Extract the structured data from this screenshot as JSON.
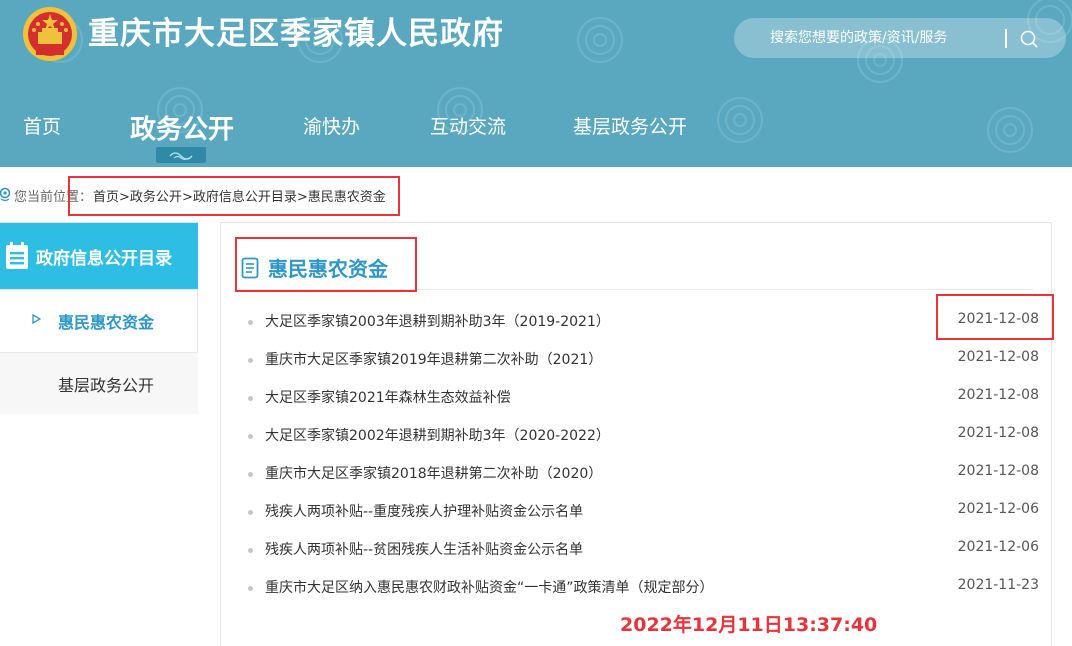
{
  "header": {
    "site_title": "重庆市大足区季家镇人民政府",
    "search_placeholder": "搜索您想要的政策/资讯/服务",
    "nav": [
      {
        "label": "首页"
      },
      {
        "label": "政务公开",
        "active": true
      },
      {
        "label": "渝快办"
      },
      {
        "label": "互动交流"
      },
      {
        "label": "基层政务公开"
      }
    ]
  },
  "breadcrumb": {
    "label": "您当前位置：",
    "items": [
      "首页",
      "政务公开",
      "政府信息公开目录",
      "惠民惠农资金"
    ],
    "separator": ">"
  },
  "sidebar": {
    "title": "政府信息公开目录",
    "items": [
      {
        "label": "惠民惠农资金",
        "active": true
      },
      {
        "label": "基层政务公开",
        "active": false
      }
    ]
  },
  "main": {
    "title": "惠民惠农资金",
    "rows": [
      {
        "title": "大足区季家镇2003年退耕到期补助3年（2019-2021）",
        "date": "2021-12-08"
      },
      {
        "title": "重庆市大足区季家镇2019年退耕第二次补助（2021）",
        "date": "2021-12-08"
      },
      {
        "title": "大足区季家镇2021年森林生态效益补偿",
        "date": "2021-12-08"
      },
      {
        "title": "大足区季家镇2002年退耕到期补助3年（2020-2022）",
        "date": "2021-12-08"
      },
      {
        "title": "重庆市大足区季家镇2018年退耕第二次补助（2020）",
        "date": "2021-12-08"
      },
      {
        "title": "残疾人两项补贴--重度残疾人护理补贴资金公示名单",
        "date": "2021-12-06"
      },
      {
        "title": "残疾人两项补贴--贫困残疾人生活补贴资金公示名单",
        "date": "2021-12-06"
      },
      {
        "title": "重庆市大足区纳入惠民惠农财政补贴资金“一卡通”政策清单（规定部分）",
        "date": "2021-11-23"
      }
    ]
  },
  "timestamp": "2022年12月11日13:37:40",
  "colors": {
    "header_bg": "#5aa8bf",
    "sidebar_head": "#2ebde3",
    "accent": "#2e97c8",
    "annotation_red": "#e8333a"
  }
}
